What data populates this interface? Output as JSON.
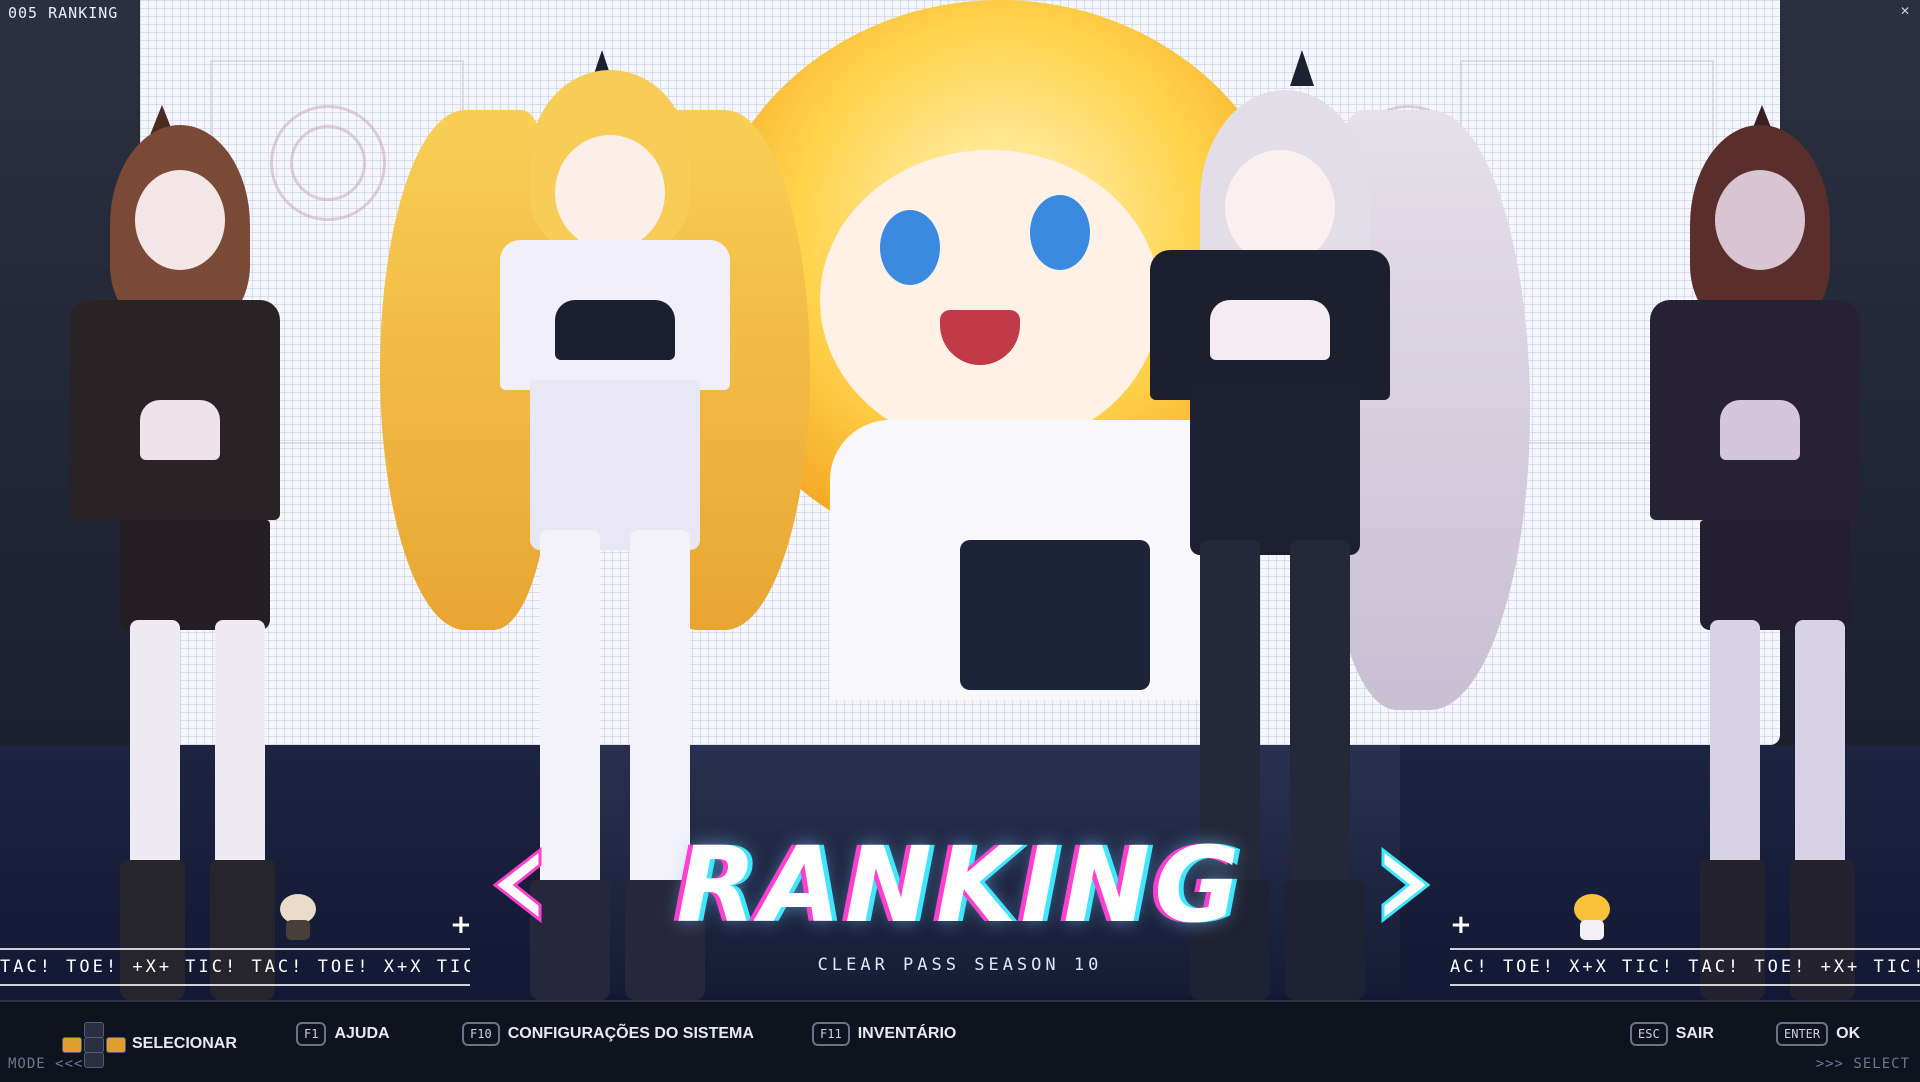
{
  "header": {
    "label": "005 RANKING"
  },
  "title": "RANKING",
  "subtitle": "CLEAR PASS SEASON 10",
  "ticker": {
    "left": "TAC! TOE! +X+ TIC! TAC! TOE! X+X TIC! TAC",
    "right": "AC! TOE! X+X TIC! TAC! TOE! +X+ TIC! TAC"
  },
  "controls": {
    "select_label": "SELECIONAR",
    "help_key": "F1",
    "help_label": "AJUDA",
    "system_key": "F10",
    "system_label": "CONFIGURAÇÕES DO SISTEMA",
    "inventory_key": "F11",
    "inventory_label": "INVENTÁRIO",
    "exit_key": "ESC",
    "exit_label": "SAIR",
    "ok_key": "ENTER",
    "ok_label": "OK"
  },
  "footer": {
    "mode_left": "MODE <<<",
    "mode_right": ">>> SELECT"
  },
  "colors": {
    "accent_pink": "#ff3fd0",
    "accent_cyan": "#3fe6ff",
    "screen_bg": "#f4f6fb"
  },
  "icons": [
    "dpad-icon",
    "arrow-left-icon",
    "arrow-right-icon",
    "enter-key-icon",
    "close-icon"
  ]
}
